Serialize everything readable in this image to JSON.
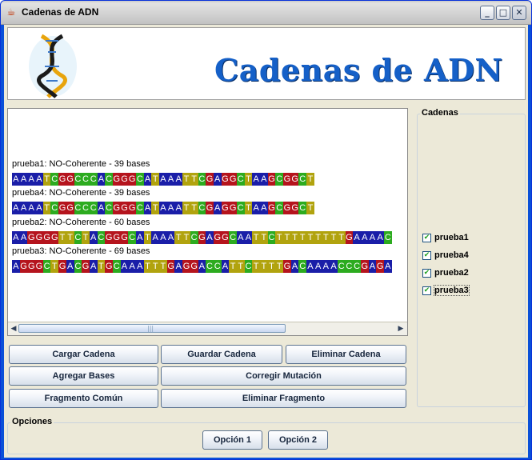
{
  "window": {
    "title": "Cadenas de ADN",
    "title_icon": "java-cup-icon",
    "controls": [
      "_",
      "□",
      "✕"
    ]
  },
  "banner": {
    "title": "Cadenas de ADN",
    "logo": "dna-helix-logo"
  },
  "base_colors": {
    "A": "#1a1ea8",
    "T": "#b1a30e",
    "C": "#2cab1f",
    "G": "#b5141d"
  },
  "sequences": [
    {
      "name": "prueba1",
      "label": "prueba1: NO-Coherente - 39 bases",
      "bases": "AAAATCGGCCCACGGGCATAAATTCGAGGCTAAGCGGCT"
    },
    {
      "name": "prueba4",
      "label": "prueba4: NO-Coherente - 39 bases",
      "bases": "AAAATCGGCCCACGGGCATAAATTCGAGGCTAAGCGGCT"
    },
    {
      "name": "prueba2",
      "label": "prueba2: NO-Coherente - 60 bases",
      "bases": "AAGGGGTTCTACGGGCATAAATTCGAGGCAATTCTTTTTTTTTGAAAAC"
    },
    {
      "name": "prueba3",
      "label": "prueba3: NO-Coherente - 69 bases",
      "bases": "AGGGCTGACGATGCAAATTTGAGGACCATTCTTTTGACAAAACCCGAGA"
    }
  ],
  "scroll": {
    "grip": "|||",
    "left_arrow": "◀",
    "right_arrow": "▶"
  },
  "buttons": {
    "cargar": "Cargar Cadena",
    "guardar": "Guardar Cadena",
    "eliminar": "Eliminar Cadena",
    "agregar": "Agregar Bases",
    "corregir": "Corregir Mutación",
    "fragmento_comun": "Fragmento Común",
    "eliminar_fragmento": "Eliminar Fragmento"
  },
  "cadenas": {
    "title": "Cadenas",
    "items": [
      {
        "label": "prueba1",
        "checked": true
      },
      {
        "label": "prueba4",
        "checked": true
      },
      {
        "label": "prueba2",
        "checked": true
      },
      {
        "label": "prueba3",
        "checked": true
      }
    ]
  },
  "opciones": {
    "title": "Opciones",
    "option1": "Opción 1",
    "option2": "Opción 2"
  }
}
